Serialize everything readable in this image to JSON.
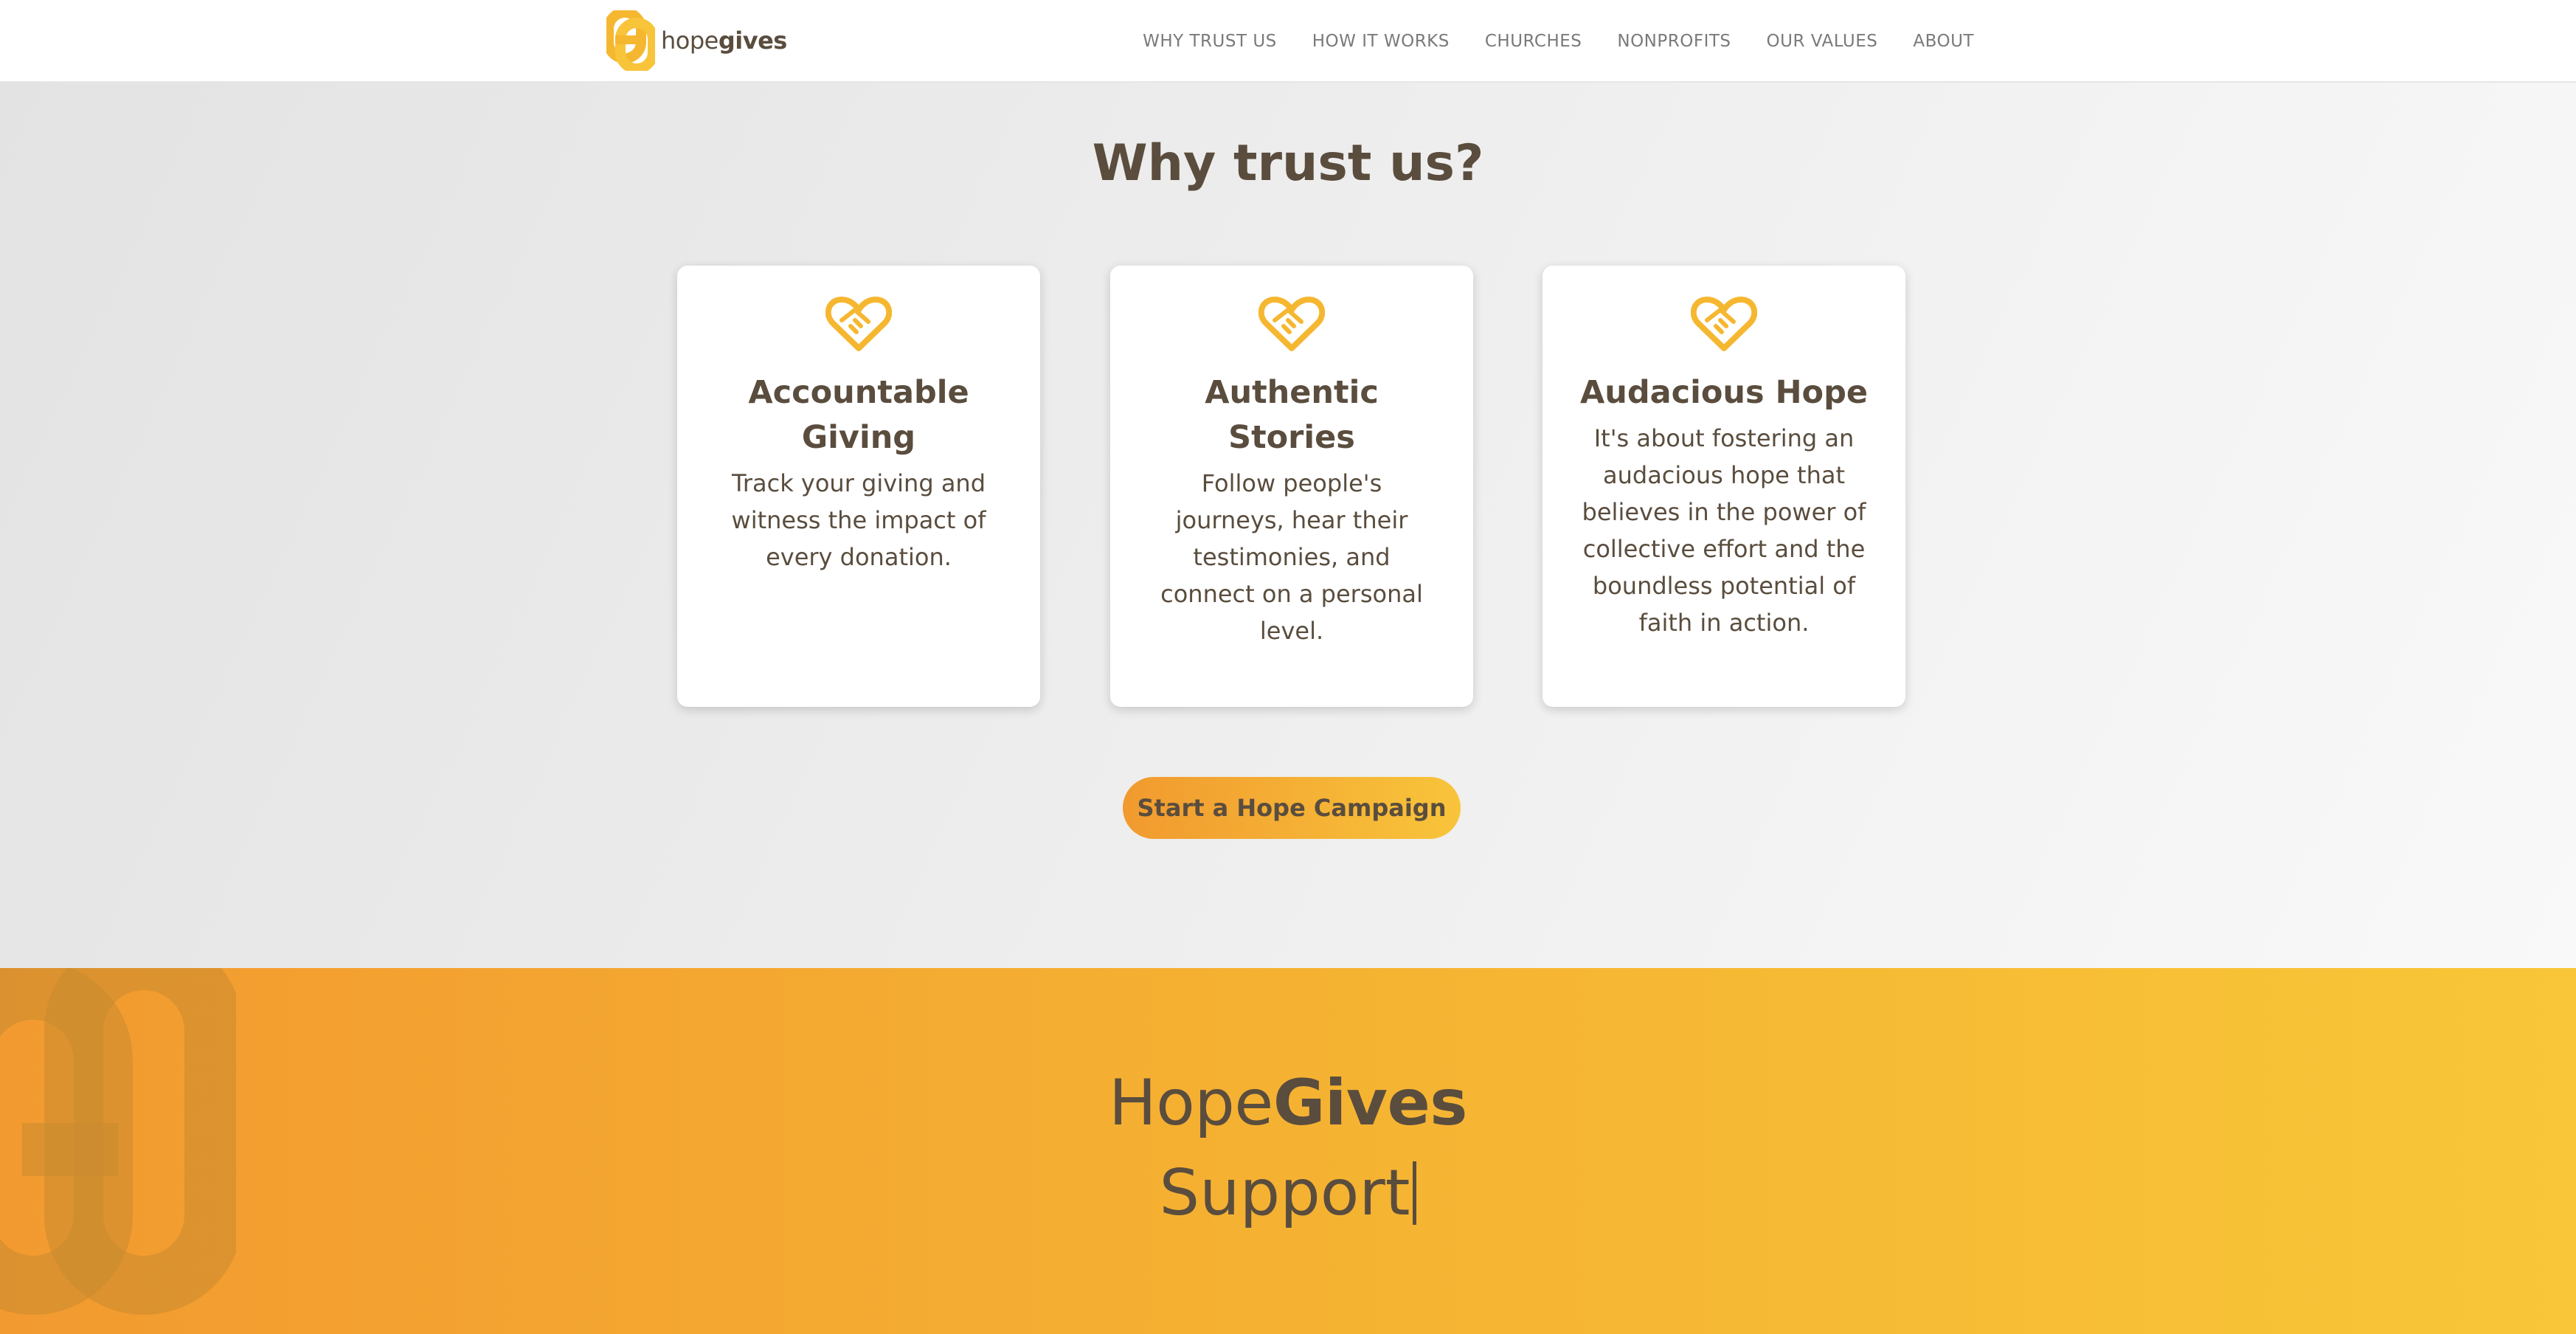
{
  "brand": {
    "name_light": "hope",
    "name_bold": "gives",
    "color_primary": "#f6b730",
    "color_text": "#5a4d3e"
  },
  "nav": {
    "items": [
      {
        "label": "WHY TRUST US"
      },
      {
        "label": "HOW IT WORKS"
      },
      {
        "label": "CHURCHES"
      },
      {
        "label": "NONPROFITS"
      },
      {
        "label": "OUR VALUES"
      },
      {
        "label": "ABOUT"
      }
    ]
  },
  "trust": {
    "title": "Why trust us?",
    "cards": [
      {
        "icon": "heart-handshake-icon",
        "title": "Accountable Giving",
        "text": "Track your giving and witness the impact of every donation."
      },
      {
        "icon": "heart-handshake-icon",
        "title": "Authentic Stories",
        "text": "Follow people's journeys, hear their testimonies, and connect on a personal level."
      },
      {
        "icon": "heart-handshake-icon",
        "title": "Audacious Hope",
        "text": "It's about fostering an audacious hope that believes in the power of collective effort and the boundless potential of faith in action."
      }
    ],
    "cta_label": "Start a Hope Campaign"
  },
  "band": {
    "title_light": "Hope",
    "title_bold": "Gives",
    "subtitle": "Support"
  }
}
